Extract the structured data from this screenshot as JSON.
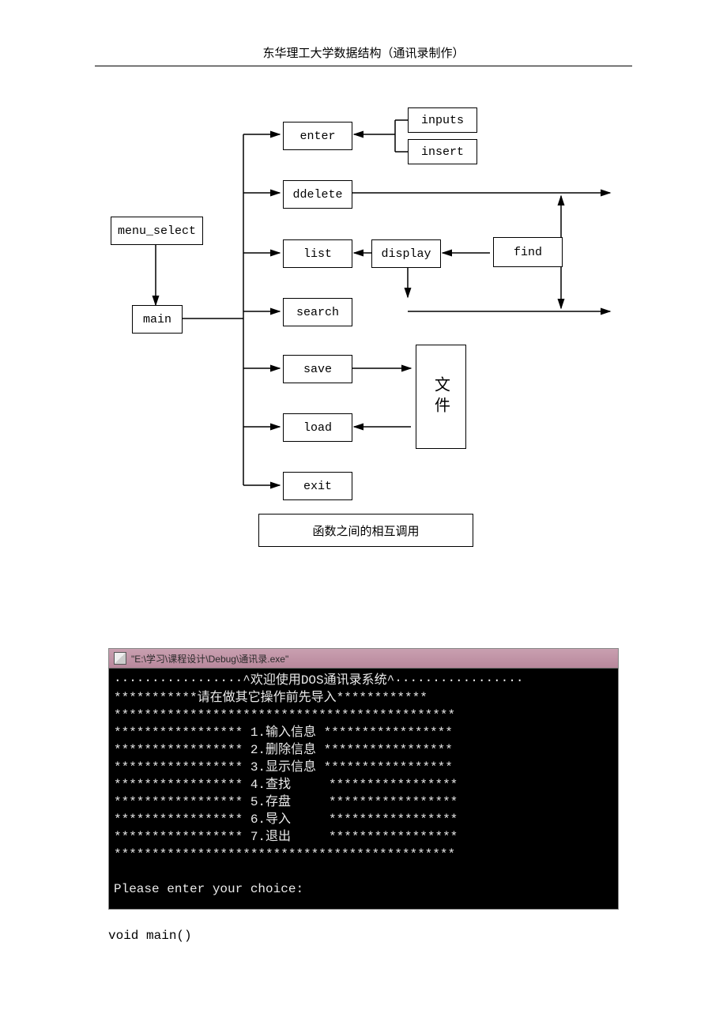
{
  "header": "东华理工大学数据结构（通讯录制作）",
  "diagram": {
    "menu_select": "menu_select",
    "main": "main",
    "enter": "enter",
    "ddelete": "ddelete",
    "list": "list",
    "search": "search",
    "save": "save",
    "load": "load",
    "exit": "exit",
    "inputs": "inputs",
    "insert": "insert",
    "display": "display",
    "find": "find",
    "file": "文件"
  },
  "caption": "函数之间的相互调用",
  "console": {
    "title": "\"E:\\学习\\课程设计\\Debug\\通讯录.exe\"",
    "line1": "·················^欢迎使用DOS通讯录系统^·················",
    "line2": "***********请在做其它操作前先导入************",
    "line3": "*********************************************",
    "m1": "***************** 1.输入信息 *****************",
    "m2": "***************** 2.删除信息 *****************",
    "m3": "***************** 3.显示信息 *****************",
    "m4": "***************** 4.查找     *****************",
    "m5": "***************** 5.存盘     *****************",
    "m6": "***************** 6.导入     *****************",
    "m7": "***************** 7.退出     *****************",
    "line4": "*********************************************",
    "prompt": "Please enter your choice:"
  },
  "code": "void main()"
}
